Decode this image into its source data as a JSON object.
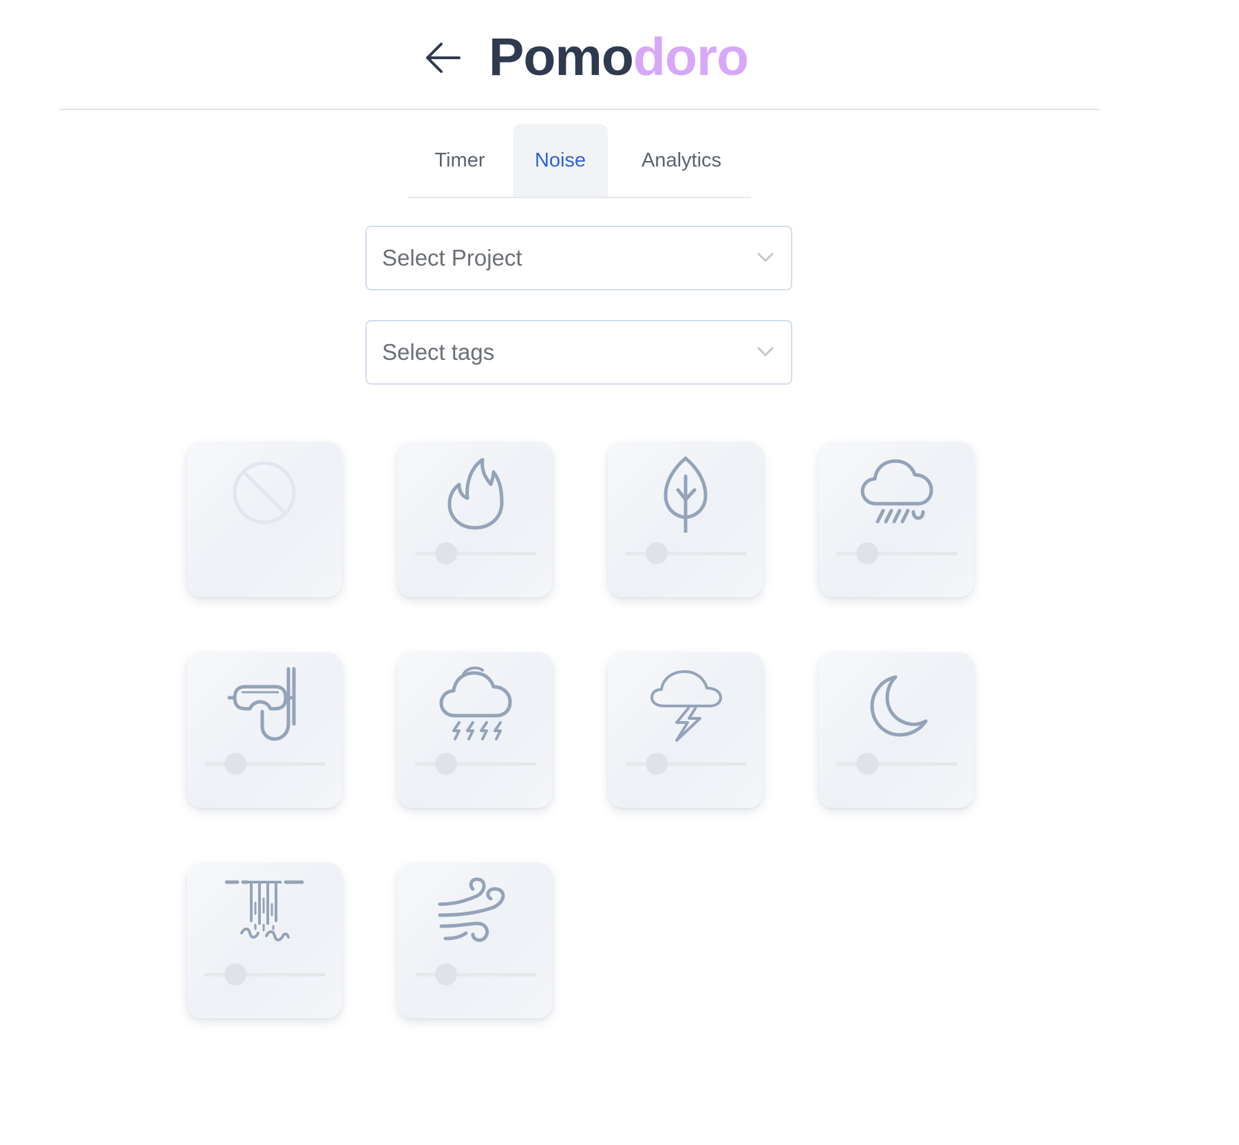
{
  "header": {
    "back_icon": "arrow-left-icon",
    "title_main": "Pomo",
    "title_accent": "doro",
    "accent_color": "#d8a8f8",
    "title_color": "#2f3a4e"
  },
  "tabs": [
    {
      "label": "Timer",
      "active": false
    },
    {
      "label": "Noise",
      "active": true
    },
    {
      "label": "Analytics",
      "active": false
    }
  ],
  "selects": {
    "project": {
      "placeholder": "Select Project",
      "icon": "chevron-down-icon"
    },
    "tags": {
      "placeholder": "Select tags",
      "icon": "chevron-down-icon"
    }
  },
  "noise_sounds": [
    {
      "icon": "none-icon",
      "volume": null
    },
    {
      "icon": "fire-icon",
      "volume": 0.25
    },
    {
      "icon": "leaf-icon",
      "volume": 0.25
    },
    {
      "icon": "rain-icon",
      "volume": 0.25
    },
    {
      "icon": "snorkel-icon",
      "volume": 0.25
    },
    {
      "icon": "storm-icon",
      "volume": 0.25
    },
    {
      "icon": "thunder-icon",
      "volume": 0.25
    },
    {
      "icon": "moon-icon",
      "volume": 0.25
    },
    {
      "icon": "waterfall-icon",
      "volume": 0.25
    },
    {
      "icon": "wind-icon",
      "volume": 0.25
    }
  ],
  "colors": {
    "active_tab": "#2b63d9",
    "icon_stroke": "#94a3b8",
    "disabled_icon": "#e2e6ee"
  }
}
